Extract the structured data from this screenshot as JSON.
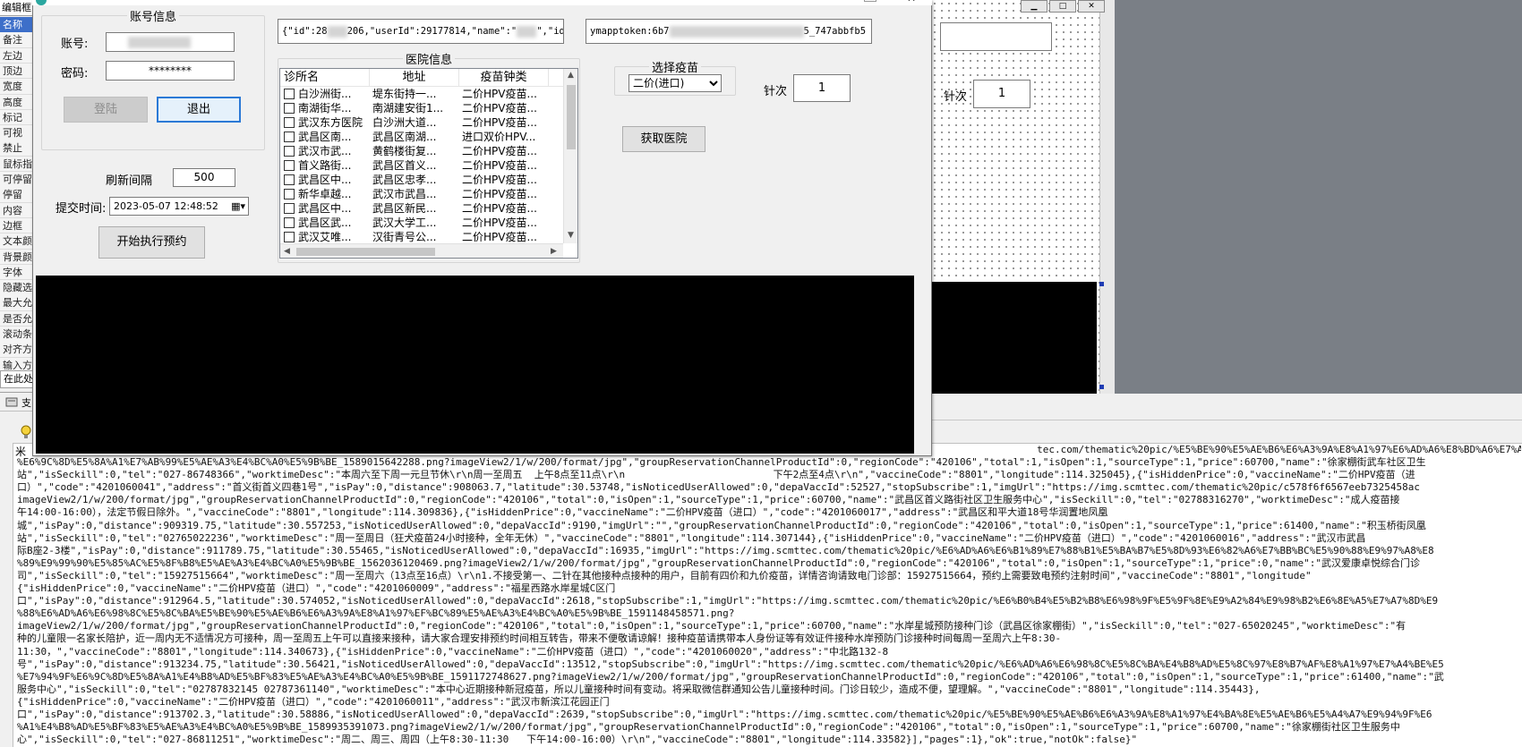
{
  "left_panel": {
    "header": "编辑框",
    "props": [
      "名称",
      "备注",
      "左边",
      "顶边",
      "宽度",
      "高度",
      "标记",
      "可视",
      "禁止",
      "鼠标指",
      "可停留",
      "停留",
      "内容",
      "边框",
      "文本颜",
      "背景颜",
      "字体",
      "隐藏选",
      "最大允",
      "是否允",
      "滚动条",
      "对齐方",
      "输入方"
    ],
    "in_this": "在此处"
  },
  "designer": {
    "needle_label": "针次",
    "needle_value": "1"
  },
  "dialog": {
    "account": {
      "group_title": "账号信息",
      "username_label": "账号:",
      "password_label": "密码:",
      "password_value": "********",
      "login_button": "登陆",
      "logout_button": "退出"
    },
    "refresh_label": "刷新间隔",
    "refresh_value": "500",
    "submit_time_label": "提交时间:",
    "submit_time_value": "2023-05-07 12:48:52",
    "start_button": "开始执行预约",
    "json_box_start": "{\"id\":28",
    "json_box_mid": "206,\"userId\":29177814,\"name\":\"",
    "json_box_end": "\",\"idCar",
    "token_start": "ymapptoken:6b7",
    "token_end": "5_747abbfb5",
    "hospital": {
      "group_title": "医院信息",
      "columns": [
        "诊所名",
        "地址",
        "疫苗钟类"
      ],
      "rows": [
        [
          "白沙洲街...",
          "堤东街持一...",
          "二价HPV疫苗..."
        ],
        [
          "南湖街华...",
          "南湖建安街1...",
          "二价HPV疫苗..."
        ],
        [
          "武汉东方医院",
          "白沙洲大道...",
          "二价HPV疫苗..."
        ],
        [
          "武昌区南...",
          "武昌区南湖...",
          "进口双价HPV..."
        ],
        [
          "武汉市武...",
          "黄鹤楼街复...",
          "二价HPV疫苗..."
        ],
        [
          "首义路街...",
          "武昌区首义...",
          "二价HPV疫苗..."
        ],
        [
          "武昌区中...",
          "武昌区忠孝...",
          "二价HPV疫苗..."
        ],
        [
          "新华卓越...",
          "武汉市武昌...",
          "二价HPV疫苗..."
        ],
        [
          "武昌区中...",
          "武昌区新民...",
          "二价HPV疫苗..."
        ],
        [
          "武昌区武...",
          "武汉大学工...",
          "二价HPV疫苗..."
        ],
        [
          "武汉艾唯...",
          "汉街青号公...",
          "二价HPV疫苗..."
        ]
      ]
    },
    "vaccine": {
      "group_title": "选择疫苗",
      "selected": "二价(进口)"
    },
    "needle_label": "针次",
    "needle_value": "1",
    "get_hospital_button": "获取医院"
  },
  "output": {
    "prefix": "米",
    "lines": [
      "                                                                                                                                                                            tec.com/thematic%20pic/%E5%BE%90%E5%AE%B6%E6%A3%9A%E8%A1%97%E6%AD%A6%E8%BD%A6%E7%A4%BE%E5%8C%BA%",
      "%E6%9C%8D%E5%8A%A1%E7%AB%99%E5%AE%A3%E4%BC%A0%E5%9B%BE_1589015642288.png?imageView2/1/w/200/format/jpg\",\"groupReservationChannelProductId\":0,\"regionCode\":\"420106\",\"total\":1,\"isOpen\":1,\"sourceType\":1,\"price\":60700,\"name\":\"徐家棚街武车社区卫生",
      "站\",\"isSeckill\":0,\"tel\":\"027-86748366\",\"worktimeDesc\":\"本周六至下周一元旦节休\\r\\n周一至周五  上午8点至11点\\r\\n                         下午2点至4点\\r\\n\",\"vaccineCode\":\"8801\",\"longitude\":114.325045},{\"isHiddenPrice\":0,\"vaccineName\":\"二价HPV疫苗（进",
      "口）\",\"code\":\"4201060041\",\"address\":\"首义街首义四巷1号\",\"isPay\":0,\"distance\":908063.7,\"latitude\":30.53748,\"isNoticedUserAllowed\":0,\"depaVaccId\":52527,\"stopSubscribe\":1,\"imgUrl\":\"https://img.scmttec.com/thematic%20pic/c578f6f6567eeb7325458ac",
      "imageView2/1/w/200/format/jpg\",\"groupReservationChannelProductId\":0,\"regionCode\":\"420106\",\"total\":0,\"isOpen\":1,\"sourceType\":1,\"price\":60700,\"name\":\"武昌区首义路街社区卫生服务中心\",\"isSeckill\":0,\"tel\":\"02788316270\",\"worktimeDesc\":\"成人疫苗接",
      "午14:00-16:00），法定节假日除外。\",\"vaccineCode\":\"8801\",\"longitude\":114.309836},{\"isHiddenPrice\":0,\"vaccineName\":\"二价HPV疫苗（进口）\",\"code\":\"4201060017\",\"address\":\"武昌区和平大道18号华润置地凤凰",
      "城\",\"isPay\":0,\"distance\":909319.75,\"latitude\":30.557253,\"isNoticedUserAllowed\":0,\"depaVaccId\":9190,\"imgUrl\":\"\",\"groupReservationChannelProductId\":0,\"regionCode\":\"420106\",\"total\":0,\"isOpen\":1,\"sourceType\":1,\"price\":61400,\"name\":\"积玉桥街凤凰",
      "站\",\"isSeckill\":0,\"tel\":\"02765022236\",\"worktimeDesc\":\"周一至周日（狂犬疫苗24小时接种，全年无休）\",\"vaccineCode\":\"8801\",\"longitude\":114.307144},{\"isHiddenPrice\":0,\"vaccineName\":\"二价HPV疫苗（进口）\",\"code\":\"4201060016\",\"address\":\"武汉市武昌",
      "际B座2-3楼\",\"isPay\":0,\"distance\":911789.75,\"latitude\":30.55465,\"isNoticedUserAllowed\":0,\"depaVaccId\":16935,\"imgUrl\":\"https://img.scmttec.com/thematic%20pic/%E6%AD%A6%E6%B1%89%E7%88%B1%E5%BA%B7%E5%8D%93%E6%82%A6%E7%BB%BC%E5%90%88%E9%97%A8%E8",
      "%89%E9%99%90%E5%85%AC%E5%8F%B8%E5%AE%A3%E4%BC%A0%E5%9B%BE_1562036120469.png?imageView2/1/w/200/format/jpg\",\"groupReservationChannelProductId\":0,\"regionCode\":\"420106\",\"total\":0,\"isOpen\":1,\"sourceType\":1,\"price\":0,\"name\":\"武汉爱康卓悦综合门诊",
      "司\",\"isSeckill\":0,\"tel\":\"15927515664\",\"worktimeDesc\":\"周一至周六（13点至16点）\\r\\n1.不接受第一、二针在其他接种点接种的用户，目前有四价和九价疫苗，详情咨询请致电门诊部：15927515664，预约上需要致电预约注射时间\",\"vaccineCode\":\"8801\",\"longitude\"",
      "{\"isHiddenPrice\":0,\"vaccineName\":\"二价HPV疫苗（进口）\",\"code\":\"4201060009\",\"address\":\"福星西路水岸星城C区门",
      "口\",\"isPay\":0,\"distance\":912964.5,\"latitude\":30.574052,\"isNoticedUserAllowed\":0,\"depaVaccId\":2618,\"stopSubscribe\":1,\"imgUrl\":\"https://img.scmttec.com/thematic%20pic/%E6%B0%B4%E5%B2%B8%E6%98%9F%E5%9F%8E%E9%A2%84%E9%98%B2%E6%8E%A5%E7%A7%8D%E9",
      "%88%E6%AD%A6%E6%98%8C%E5%8C%BA%E5%BE%90%E5%AE%B6%E6%A3%9A%E8%A1%97%EF%BC%89%E5%AE%A3%E4%BC%A0%E5%9B%BE_1591148458571.png?",
      "imageView2/1/w/200/format/jpg\",\"groupReservationChannelProductId\":0,\"regionCode\":\"420106\",\"total\":0,\"isOpen\":1,\"sourceType\":1,\"price\":60700,\"name\":\"水岸星城预防接种门诊（武昌区徐家棚街）\",\"isSeckill\":0,\"tel\":\"027-65020245\",\"worktimeDesc\":\"有",
      "种的儿童限一名家长陪护，近一周内无不适情况方可接种，周一至周五上午可以直接来接种，请大家合理安排预约时间相互转告，带来不便敬请谅解！接种疫苗请携带本人身份证等有效证件接种水岸预防门诊接种时间每周一至周六上午8:30-",
      "11:30，\",\"vaccineCode\":\"8801\",\"longitude\":114.340673},{\"isHiddenPrice\":0,\"vaccineName\":\"二价HPV疫苗（进口）\",\"code\":\"4201060020\",\"address\":\"中北路132-8",
      "号\",\"isPay\":0,\"distance\":913234.75,\"latitude\":30.56421,\"isNoticedUserAllowed\":0,\"depaVaccId\":13512,\"stopSubscribe\":0,\"imgUrl\":\"https://img.scmttec.com/thematic%20pic/%E6%AD%A6%E6%98%8C%E5%8C%BA%E4%B8%AD%E5%8C%97%E8%B7%AF%E8%A1%97%E7%A4%BE%E5",
      "%E7%94%9F%E6%9C%8D%E5%8A%A1%E4%B8%AD%E5%BF%83%E5%AE%A3%E4%BC%A0%E5%9B%BE_1591172748627.png?imageView2/1/w/200/format/jpg\",\"groupReservationChannelProductId\":0,\"regionCode\":\"420106\",\"total\":0,\"isOpen\":1,\"sourceType\":1,\"price\":61400,\"name\":\"武",
      "服务中心\",\"isSeckill\":0,\"tel\":\"02787832145 02787361140\",\"worktimeDesc\":\"本中心近期接种新冠疫苗，所以儿童接种时间有变动。将采取微信群通知公告儿童接种时间。门诊日较少，造成不便，望理解。\",\"vaccineCode\":\"8801\",\"longitude\":114.35443},",
      "{\"isHiddenPrice\":0,\"vaccineName\":\"二价HPV疫苗（进口）\",\"code\":\"4201060011\",\"address\":\"武汉市新滨江花园正门",
      "口\",\"isPay\":0,\"distance\":913702.3,\"latitude\":30.58886,\"isNoticedUserAllowed\":0,\"depaVaccId\":2639,\"stopSubscribe\":0,\"imgUrl\":\"https://img.scmttec.com/thematic%20pic/%E5%BE%90%E5%AE%B6%E6%A3%9A%E8%A1%97%E4%BA%8E%E5%AE%B6%E5%A4%A7%E9%94%9F%E6",
      "%A1%E4%B8%AD%E5%BF%83%E5%AE%A3%E4%BC%A0%E5%9B%BE_1589935391073.png?imageView2/1/w/200/format/jpg\",\"groupReservationChannelProductId\":0,\"regionCode\":\"420106\",\"total\":0,\"isOpen\":1,\"sourceType\":1,\"price\":60700,\"name\":\"徐家棚街社区卫生服务中",
      "心\",\"isSeckill\":0,\"tel\":\"027-86811251\",\"worktimeDesc\":\"周二、周三、周四（上午8:30-11:30   下午14:00-16:00）\\r\\n\",\"vaccineCode\":\"8801\",\"longitude\":114.33582}],\"pages\":1},\"ok\":true,\"notOk\":false}\""
    ]
  }
}
